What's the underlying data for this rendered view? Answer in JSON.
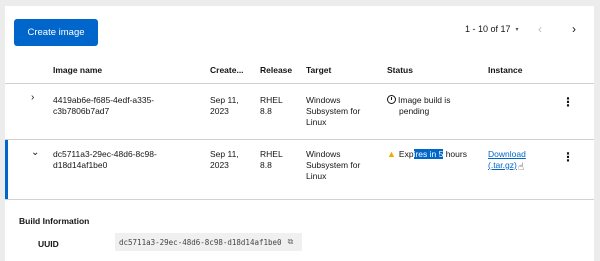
{
  "toolbar": {
    "create_label": "Create image",
    "pager_label": "1 - 10 of 17",
    "pager_caret": "▾",
    "prev_icon": "‹",
    "next_icon": "›"
  },
  "table": {
    "headers": [
      "Image name",
      "Create...",
      "Release",
      "Target",
      "Status",
      "Instance"
    ],
    "rows": [
      {
        "toggle": "›",
        "name_line1": "4419ab6e-f685-4edf-a335-",
        "name_line2": "c3b7806b7ad7",
        "created_line1": "Sep 11,",
        "created_line2": "2023",
        "release_line1": "RHEL",
        "release_line2": "8.8",
        "target_line1": "Windows",
        "target_line2": "Subsystem for",
        "target_line3": "Linux",
        "status_line1": "Image build is",
        "status_line2": "pending"
      },
      {
        "toggle": "⌄",
        "name_line1": "dc5711a3-29ec-48d6-8c98-",
        "name_line2": "d18d14af1be0",
        "created_line1": "Sep 11,",
        "created_line2": "2023",
        "release_line1": "RHEL",
        "release_line2": "8.8",
        "target_line1": "Windows",
        "target_line2": "Subsystem for",
        "target_line3": "Linux",
        "status_pre": "Exp",
        "status_highlight": "ires in 5",
        "status_post": " hours",
        "instance_line1": "Download",
        "instance_line2": "(.tar.gz)"
      }
    ],
    "kebab": "⋮"
  },
  "details": {
    "title": "Build Information",
    "uuid_label": "UUID",
    "uuid_value": "dc5711a3-29ec-48d6-8c98-d18d14af1be0",
    "copy_icon": "⧉"
  },
  "colors": {
    "accent": "#0066cc",
    "warning": "#f0ab00"
  }
}
